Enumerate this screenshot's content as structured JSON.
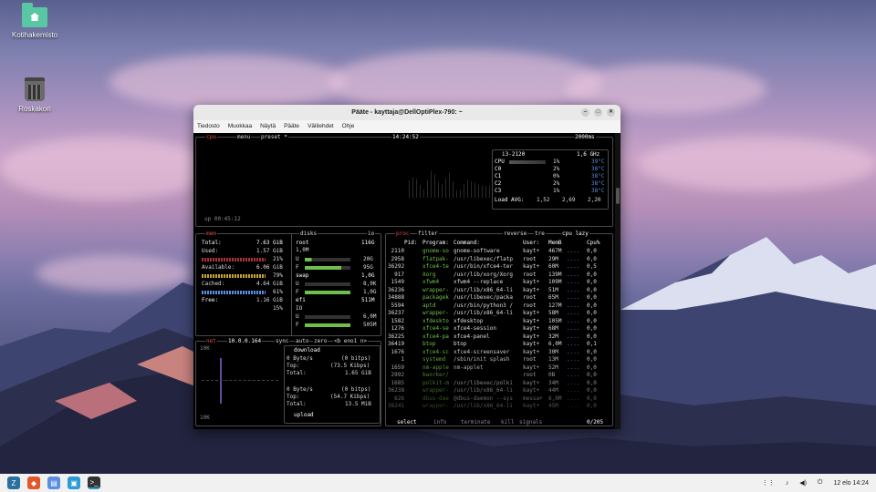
{
  "desktop": {
    "icons": [
      {
        "label": "Kotihakemisto",
        "icon": "home-folder-icon"
      },
      {
        "label": "Roskakori",
        "icon": "trash-icon"
      }
    ]
  },
  "window": {
    "title": "Pääte - kayttaja@DellOptiPlex-790: ~",
    "menu": [
      "Tiedosto",
      "Muokkaa",
      "Näytä",
      "Pääte",
      "Välilehdet",
      "Ohje"
    ]
  },
  "btop": {
    "cpu": {
      "label": "cpu",
      "menu": "menu",
      "preset": "preset *",
      "clock": "14:24:52",
      "interval": "2000ms",
      "model": "i3-2120",
      "freq": "1,6 GHz",
      "cores": [
        {
          "name": "CPU",
          "pct": "1%",
          "temp": "39°C"
        },
        {
          "name": "C0",
          "pct": "2%",
          "temp": "38°C"
        },
        {
          "name": "C1",
          "pct": "0%",
          "temp": "38°C"
        },
        {
          "name": "C2",
          "pct": "2%",
          "temp": "38°C"
        },
        {
          "name": "C3",
          "pct": "1%",
          "temp": "38°C"
        }
      ],
      "load_label": "Load AVG:",
      "load": [
        "1,52",
        "2,69",
        "2,20"
      ],
      "uptime": "up 00:45:12"
    },
    "mem": {
      "label": "mem",
      "rows": [
        {
          "k": "Total:",
          "v": "7.63 GiB"
        },
        {
          "k": "Used:",
          "v": "1.57 GiB"
        },
        {
          "k": "",
          "v": "21%"
        },
        {
          "k": "Available:",
          "v": "6.06 GiB"
        },
        {
          "k": "",
          "v": "79%"
        },
        {
          "k": "Cached:",
          "v": "4.64 GiB"
        },
        {
          "k": "",
          "v": "61%"
        },
        {
          "k": "Free:",
          "v": "1.16 GiB"
        },
        {
          "k": "",
          "v": "15%"
        }
      ]
    },
    "disks": {
      "label": "disks",
      "io": "io",
      "root": {
        "name": "root",
        "size": "116G",
        "free_label": "1,0M",
        "u": "20G",
        "f": "95G"
      },
      "swap": {
        "name": "swap",
        "size": "1,0G",
        "u": "8,0K",
        "f": "1,0G"
      },
      "efi": {
        "name": "efi",
        "size": "511M",
        "io": "IO",
        "u": "6,0M",
        "f": "505M"
      }
    },
    "net": {
      "label": "net",
      "ip": "10.0.0.164",
      "sync": "sync",
      "auto": "auto",
      "zero": "zero",
      "iface": "<b eno1 n>",
      "scale_top": "10K",
      "scale_bottom": "10K",
      "download_label": "download",
      "download": [
        {
          "k": "0 Byte/s",
          "v": "(0 bitps)"
        },
        {
          "k": "Top:",
          "v": "(73.5 Kibps)"
        },
        {
          "k": "Total:",
          "v": "1.65 GiB"
        }
      ],
      "upload": [
        {
          "k": "0 Byte/s",
          "v": "(0 bitps)"
        },
        {
          "k": "Top:",
          "v": "(54.7 Kibps)"
        },
        {
          "k": "Total:",
          "v": "13.5 MiB"
        }
      ],
      "upload_label": "upload"
    },
    "proc": {
      "label": "proc",
      "filter": "filter",
      "reverse": "reverse",
      "tree": "tre",
      "sort": "cpu lazy",
      "headers": [
        "Pid:",
        "Program:",
        "Command:",
        "User:",
        "MemB",
        "Cpu%"
      ],
      "rows": [
        [
          "2110",
          "gnome-so",
          "gnome-software",
          "kayt+",
          "467M",
          "0,0"
        ],
        [
          "2958",
          "flatpak-",
          "/usr/libexec/flatp",
          "root",
          "29M",
          "0,0"
        ],
        [
          "36292",
          "xfce4-te",
          "/usr/bin/xfce4-ter",
          "kayt+",
          "60M",
          "0,5"
        ],
        [
          "917",
          "Xorg",
          "/usr/lib/xorg/Xorg",
          "root",
          "139M",
          "0,0"
        ],
        [
          "1549",
          "xfwm4",
          "xfwm4 --replace",
          "kayt+",
          "109M",
          "0,0"
        ],
        [
          "36236",
          "wrapper-",
          "/usr/lib/x86_64-li",
          "kayt+",
          "51M",
          "0,0"
        ],
        [
          "34888",
          "packagek",
          "/usr/libexec/packa",
          "root",
          "65M",
          "0,0"
        ],
        [
          "5594",
          "aptd",
          "/usr/bin/python3 /",
          "root",
          "127M",
          "0,0"
        ],
        [
          "36237",
          "wrapper-",
          "/usr/lib/x86_64-li",
          "kayt+",
          "58M",
          "0,0"
        ],
        [
          "1582",
          "xfdeskto",
          "xfdesktop",
          "kayt+",
          "105M",
          "0,0"
        ],
        [
          "1276",
          "xfce4-se",
          "xfce4-session",
          "kayt+",
          "68M",
          "0,0"
        ],
        [
          "36225",
          "xfce4-pa",
          "xfce4-panel",
          "kayt+",
          "32M",
          "0,0"
        ],
        [
          "36419",
          "btop",
          "btop",
          "kayt+",
          "6,0M",
          "0,1"
        ],
        [
          "1676",
          "xfce4-sc",
          "xfce4-screensaver",
          "kayt+",
          "30M",
          "0,0"
        ],
        [
          "1",
          "systemd",
          "/sbin/init splash",
          "root",
          "13M",
          "0,0"
        ],
        [
          "1659",
          "nm-apple",
          "nm-applet",
          "kayt+",
          "52M",
          "0,0"
        ],
        [
          "2992",
          "kworker/",
          "",
          "root",
          "0B",
          "0,0"
        ],
        [
          "1685",
          "polkit-m",
          "/usr/libexec/polki",
          "kayt+",
          "34M",
          "0,0"
        ],
        [
          "36238",
          "wrapper-",
          "/usr/lib/x86_64-li",
          "kayt+",
          "44M",
          "0,0"
        ],
        [
          "626",
          "dbus-dae",
          "@dbus-daemon --sys",
          "messa+",
          "6,0M",
          "0,0"
        ],
        [
          "36241",
          "wrapper-",
          "/usr/lib/x86_64-li",
          "kayt+",
          "45M",
          "0,0"
        ]
      ],
      "footer_select": "select",
      "footer_info": "info",
      "footer_terminate": "terminate",
      "footer_kill": "kill",
      "footer_signals": "signals",
      "count": "0/205"
    }
  },
  "taskbar": {
    "clock": "12 elo 14:24",
    "apps": [
      "zorin-menu-icon",
      "brave-browser-icon",
      "files-icon",
      "software-store-icon",
      "terminal-icon"
    ],
    "tray": [
      "network-icon",
      "notifications-icon",
      "volume-icon",
      "power-icon"
    ]
  },
  "colors": {
    "accent_red": "#e04b4b",
    "btop_green": "#6ec04a",
    "btop_blue": "#5a8ee0",
    "btop_label": "#e8d5a0"
  }
}
